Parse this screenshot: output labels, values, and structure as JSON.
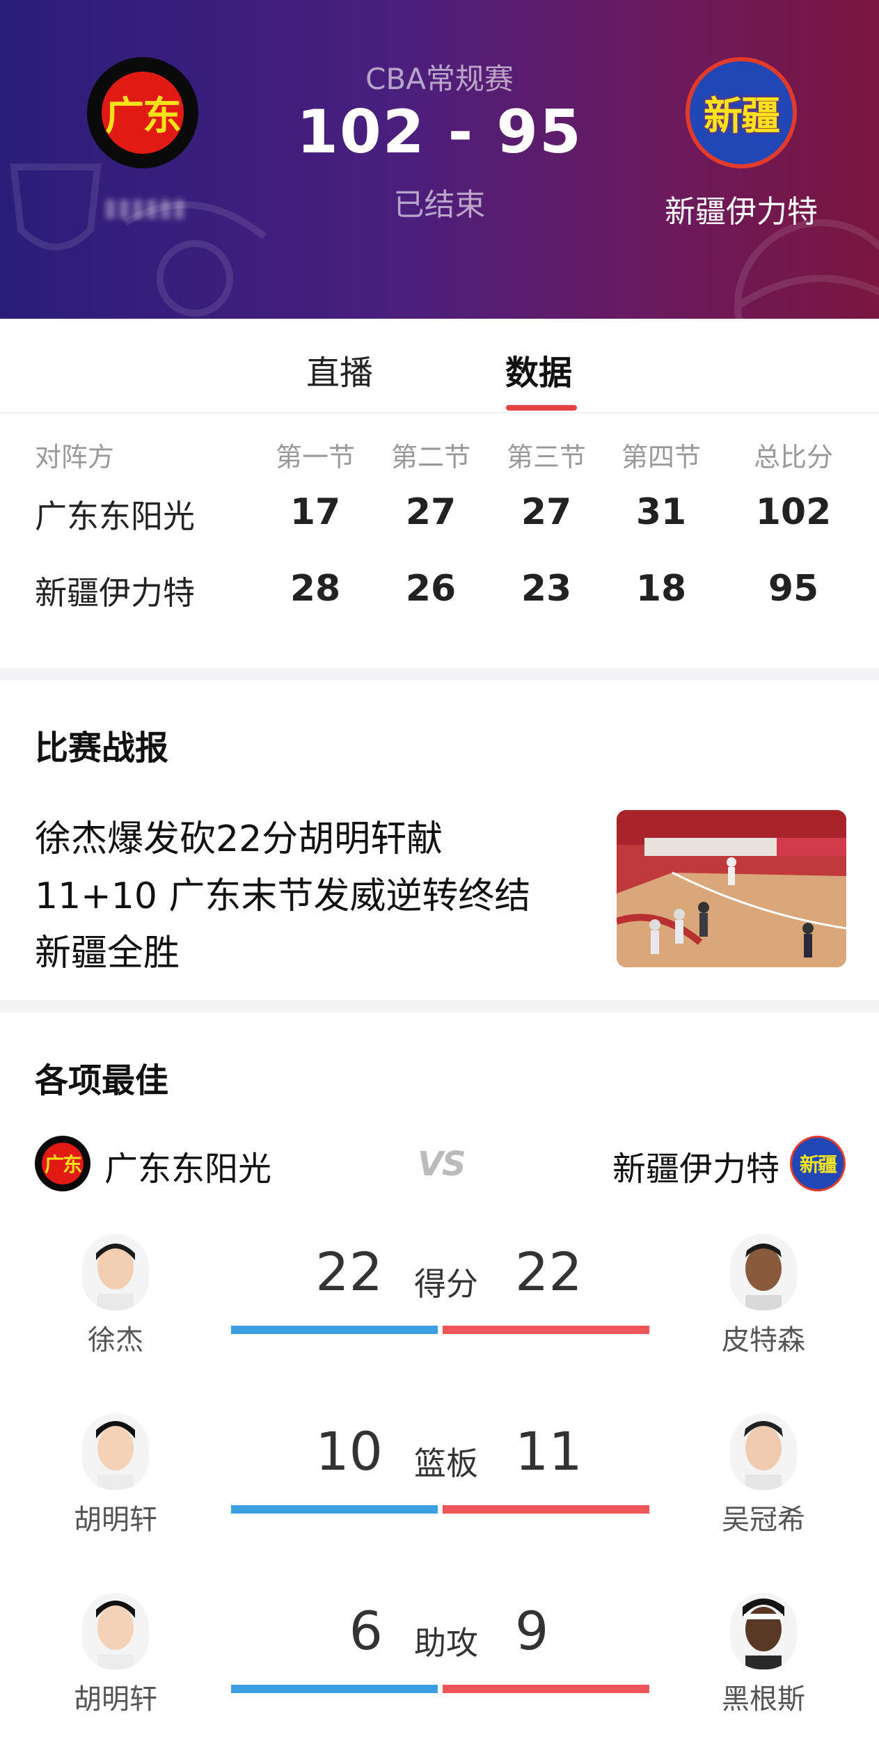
{
  "header": {
    "league": "CBA常规赛",
    "score": "102  -  95",
    "status": "已结束",
    "home_logo_text": "广东",
    "away_logo_text": "新疆",
    "away_name": "新疆伊力特",
    "colors": {
      "gradient_left": "#2a1d7a",
      "gradient_right": "#7a1640"
    }
  },
  "tabs": [
    {
      "label": "直播"
    },
    {
      "label": "数据"
    }
  ],
  "quarter_table": {
    "headers": [
      "对阵方",
      "第一节",
      "第二节",
      "第三节",
      "第四节",
      "总比分"
    ],
    "rows": [
      {
        "team": "广东东阳光",
        "q1": "17",
        "q2": "27",
        "q3": "27",
        "q4": "31",
        "total": "102"
      },
      {
        "team": "新疆伊力特",
        "q1": "28",
        "q2": "26",
        "q3": "23",
        "q4": "18",
        "total": "95"
      }
    ]
  },
  "news": {
    "section_title": "比赛战报",
    "headline_line1": "徐杰爆发砍22分胡明轩献",
    "headline_line2": "11+10 广东末节发威逆转终结",
    "headline_line3": "新疆全胜"
  },
  "best": {
    "section_title": "各项最佳",
    "home_team": "广东东阳光",
    "away_team": "新疆伊力特",
    "vs": "VS",
    "home_mini_logo": "广东",
    "away_mini_logo": "新疆",
    "stats": [
      {
        "label": "得分",
        "home_value": "22",
        "away_value": "22",
        "home_player": "徐杰",
        "away_player": "皮特森"
      },
      {
        "label": "篮板",
        "home_value": "10",
        "away_value": "11",
        "home_player": "胡明轩",
        "away_player": "吴冠希"
      },
      {
        "label": "助攻",
        "home_value": "6",
        "away_value": "9",
        "home_player": "胡明轩",
        "away_player": "黑根斯"
      }
    ],
    "colors": {
      "home_bar": "#3b9ee0",
      "away_bar": "#ee5559"
    }
  }
}
